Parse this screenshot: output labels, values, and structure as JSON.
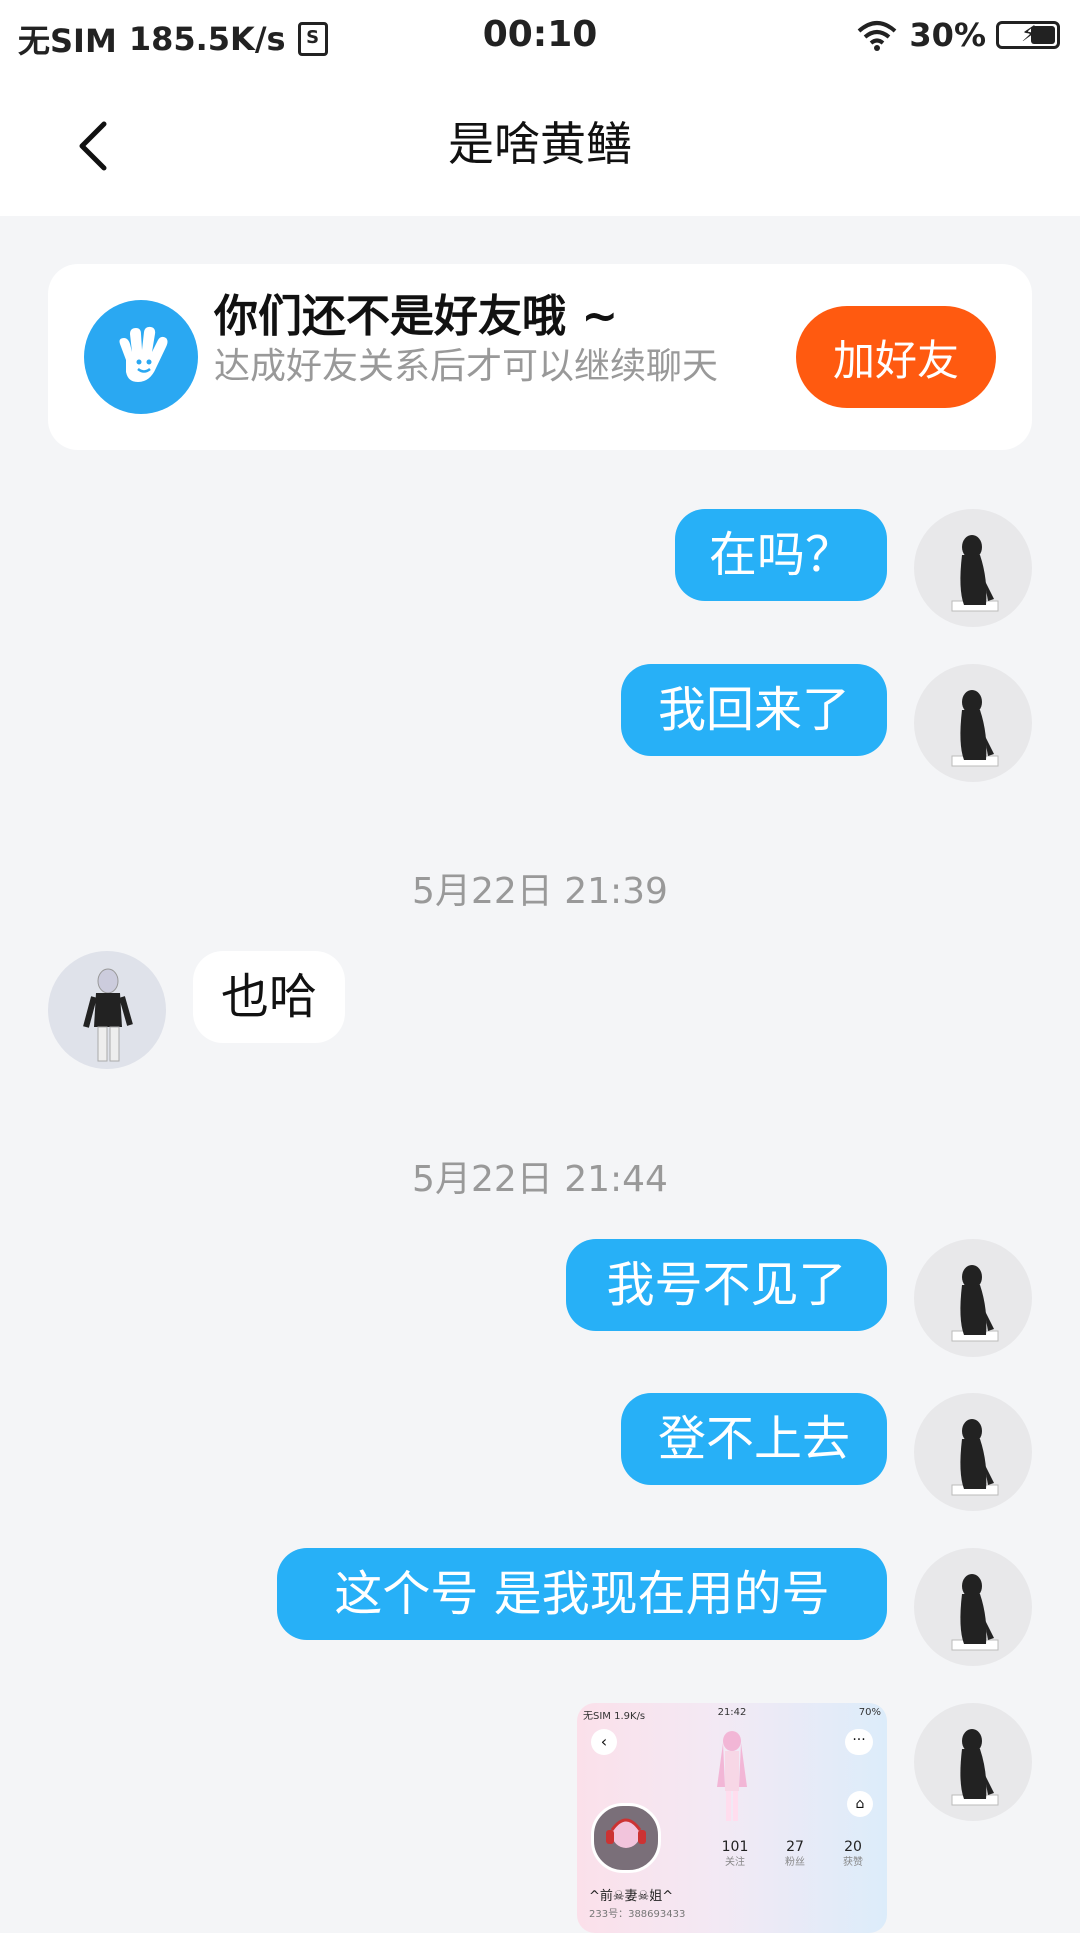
{
  "status_bar": {
    "carrier": "无SIM",
    "speed": "185.5K/s",
    "sim_badge": "S",
    "time": "00:10",
    "battery": "30%"
  },
  "nav": {
    "title": "是啥黄鳝"
  },
  "friend_card": {
    "title": "你们还不是好友哦 ~",
    "subtitle": "达成好友关系后才可以继续聊天",
    "button": "加好友"
  },
  "messages": {
    "m1": "在吗？",
    "m2": "我回来了",
    "ts1": "5月22日 21:39",
    "m3": "也哈",
    "ts2": "5月22日 21:44",
    "m4": "我号不见了",
    "m5": "登不上去",
    "m6": "这个号 是我现在用的号"
  },
  "screenshot_message": {
    "status_left": "无SIM 1.9K/s",
    "status_time": "21:42",
    "status_right": "70%",
    "stats": [
      {
        "value": "101",
        "label": "关注"
      },
      {
        "value": "27",
        "label": "粉丝"
      },
      {
        "value": "20",
        "label": "获赞"
      }
    ],
    "name": "^前☠妻☠姐^",
    "id_text": "233号：388693433"
  },
  "colors": {
    "outgoing_bubble": "#27b0f7",
    "add_friend_button": "#ff5a10",
    "background": "#f4f5f7"
  }
}
